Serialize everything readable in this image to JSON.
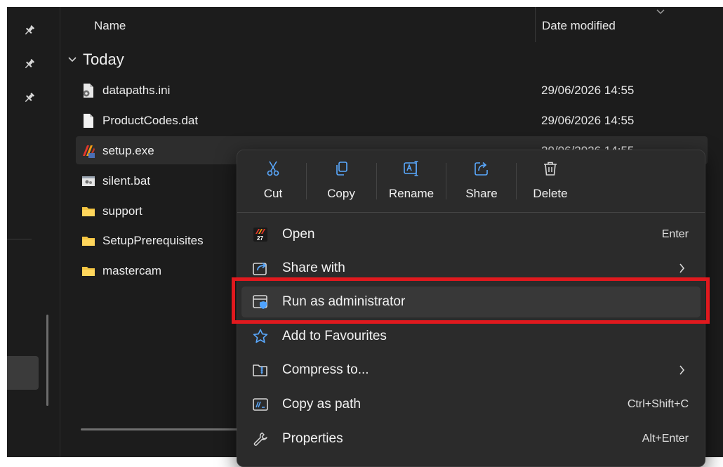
{
  "header": {
    "name_col": "Name",
    "date_col": "Date modified"
  },
  "group": {
    "label": "Today"
  },
  "files": [
    {
      "name": "datapaths.ini",
      "date": "29/06/2026 14:55",
      "icon": "ini-file-icon"
    },
    {
      "name": "ProductCodes.dat",
      "date": "29/06/2026 14:55",
      "icon": "blank-file-icon"
    },
    {
      "name": "setup.exe",
      "date": "29/06/2026 14:55",
      "icon": "mastercam-app-icon"
    },
    {
      "name": "silent.bat",
      "date": "",
      "icon": "batch-file-icon"
    },
    {
      "name": "support",
      "date": "",
      "icon": "folder-icon"
    },
    {
      "name": "SetupPrerequisites",
      "date": "",
      "icon": "folder-icon"
    },
    {
      "name": "mastercam",
      "date": "",
      "icon": "folder-icon"
    }
  ],
  "context_menu": {
    "toolbar": [
      {
        "label": "Cut",
        "icon": "scissors-icon"
      },
      {
        "label": "Copy",
        "icon": "copy-icon"
      },
      {
        "label": "Rename",
        "icon": "rename-icon"
      },
      {
        "label": "Share",
        "icon": "share-icon"
      },
      {
        "label": "Delete",
        "icon": "trash-icon"
      }
    ],
    "items": [
      {
        "label": "Open",
        "shortcut": "Enter",
        "icon": "mastercam-app-icon"
      },
      {
        "label": "Share with",
        "shortcut": "",
        "icon": "share-with-icon"
      },
      {
        "label": "Run as administrator",
        "shortcut": "",
        "icon": "shield-window-icon"
      },
      {
        "label": "Add to Favourites",
        "shortcut": "",
        "icon": "star-icon"
      },
      {
        "label": "Compress to...",
        "shortcut": "",
        "icon": "zip-icon"
      },
      {
        "label": "Copy as path",
        "shortcut": "Ctrl+Shift+C",
        "icon": "copy-path-icon"
      },
      {
        "label": "Properties",
        "shortcut": "Alt+Enter",
        "icon": "wrench-icon"
      }
    ]
  },
  "colors": {
    "highlight_border": "#e0191e",
    "menu_bg": "#2b2b2b",
    "window_bg": "#1c1c1c",
    "accent_blue": "#4fa3ff"
  }
}
